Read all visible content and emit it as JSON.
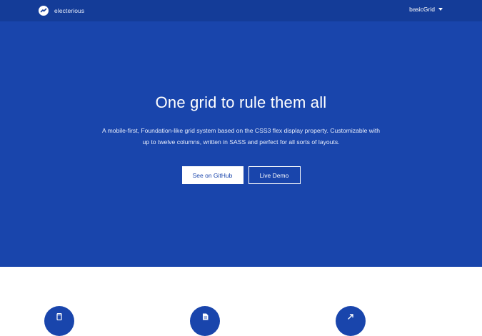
{
  "navbar": {
    "brand_name": "electerious",
    "brand_icon": "electerious-logo-icon",
    "dropdown_label": "basicGrid",
    "background": "#143c98"
  },
  "hero": {
    "title": "One grid to rule them all",
    "description": "A mobile-first, Foundation-like grid system based on the CSS3 flex display property. Customizable with up to twelve columns, written in SASS and perfect for all sorts of layouts.",
    "primary_button": "See on GitHub",
    "secondary_button": "Live Demo",
    "background": "#1945ac"
  },
  "features": {
    "icons": [
      "mobile-icon",
      "document-icon",
      "arrow-expand-icon"
    ],
    "icon_color": "#1945ac"
  }
}
